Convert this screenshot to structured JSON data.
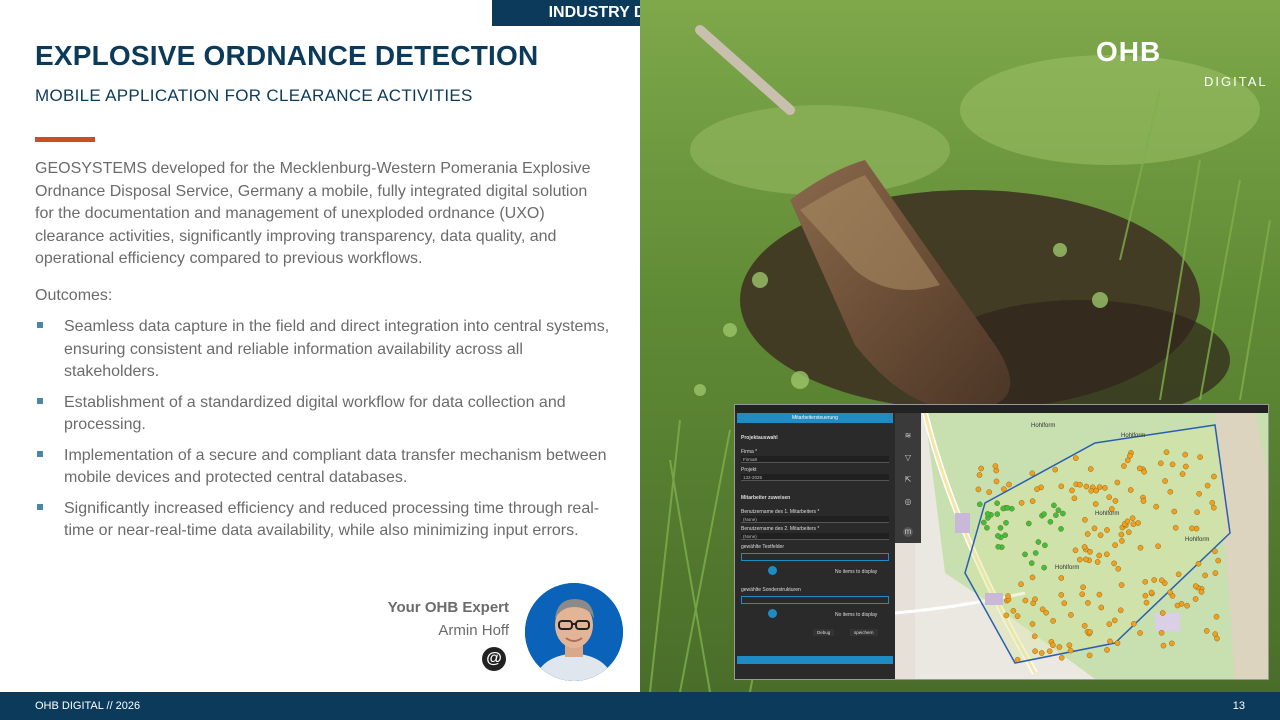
{
  "header_tag": "INDUSTRY Digital Twins",
  "title": "EXPLOSIVE ORDNANCE DETECTION",
  "subtitle": "MOBILE APPLICATION FOR CLEARANCE ACTIVITIES",
  "intro": "GEOSYSTEMS developed for the Mecklenburg-Western Pomerania Explosive Ordnance Disposal Service, Germany a mobile, fully integrated digital solution for the documentation and management of unexploded ordnance (UXO) clearance activities, significantly improving transparency, data quality, and operational efficiency compared to previous workflows.",
  "outcomes_label": "Outcomes:",
  "bullets": [
    "Seamless data capture in the field and direct integration into central systems, ensuring consistent and reliable information availability across all stakeholders.",
    "Establishment of a standardized digital workflow for data collection and processing.",
    "Implementation of a secure and compliant data transfer mechanism between mobile devices and protected central databases.",
    "Significantly increased efficiency and reduced processing time through real-time or near-real-time data availability, while also minimizing input errors."
  ],
  "expert": {
    "label": "Your OHB Expert",
    "name": "Armin Hoff"
  },
  "logo": {
    "main": "OHB",
    "sub": "DIGITAL"
  },
  "footer": {
    "left": "OHB DIGITAL // 2026",
    "page": "13"
  },
  "app": {
    "panel_header": "Mitarbeitersteuerung",
    "project_section": "Projektauswahl",
    "firm_label": "Firma *",
    "firm_value": "Firma8",
    "project_label": "Projekt",
    "project_value": "132-2025",
    "staff_section": "Mitarbeiter zuweisen",
    "user1_label": "Benutzername des 1. Mitarbeiters *",
    "user1_value": "(None)",
    "user2_label": "Benutzername des 2. Mitarbeiters *",
    "user2_value": "(None)",
    "fields_label": "gewählte Testfelder",
    "no_items_1": "No items to display",
    "special_label": "gewählte Sonderstrukturen",
    "no_items_2": "No items to display",
    "debug_btn": "Debug",
    "save_btn": "speichern",
    "map_labels": [
      "Hohlform",
      "Hohlform",
      "Hohlform",
      "Hohlform",
      "Hohlform"
    ]
  },
  "colors": {
    "navy": "#0c3a5b",
    "accent": "#c8501e",
    "bullet": "#4a86a8",
    "app_blue": "#1e8bc3"
  }
}
